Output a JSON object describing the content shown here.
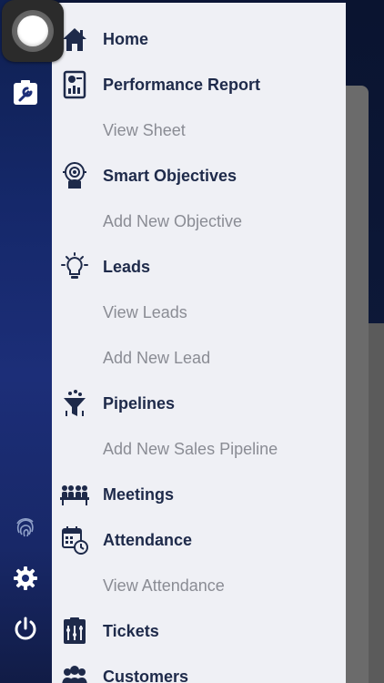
{
  "menu": {
    "items": [
      {
        "label": "Home",
        "icon": "home-icon"
      },
      {
        "label": "Performance Report",
        "icon": "report-icon"
      },
      {
        "label": "View Sheet"
      },
      {
        "label": "Smart Objectives",
        "icon": "objectives-icon"
      },
      {
        "label": "Add New Objective"
      },
      {
        "label": "Leads",
        "icon": "bulb-icon"
      },
      {
        "label": "View Leads"
      },
      {
        "label": "Add New Lead"
      },
      {
        "label": "Pipelines",
        "icon": "funnel-icon"
      },
      {
        "label": "Add New Sales Pipeline"
      },
      {
        "label": "Meetings",
        "icon": "meeting-icon"
      },
      {
        "label": "Attendance",
        "icon": "calendar-clock-icon"
      },
      {
        "label": "View Attendance"
      },
      {
        "label": "Tickets",
        "icon": "tickets-icon"
      },
      {
        "label": "Customers",
        "icon": "customers-icon"
      }
    ]
  },
  "rail": {
    "icons": [
      "tools-icon",
      "fingerprint-icon",
      "gear-icon",
      "power-icon"
    ]
  },
  "colors": {
    "rail": "#15286a",
    "drawer": "#eff0f5",
    "primary_text": "#1e2a4a",
    "secondary_text": "#8a8c94"
  }
}
